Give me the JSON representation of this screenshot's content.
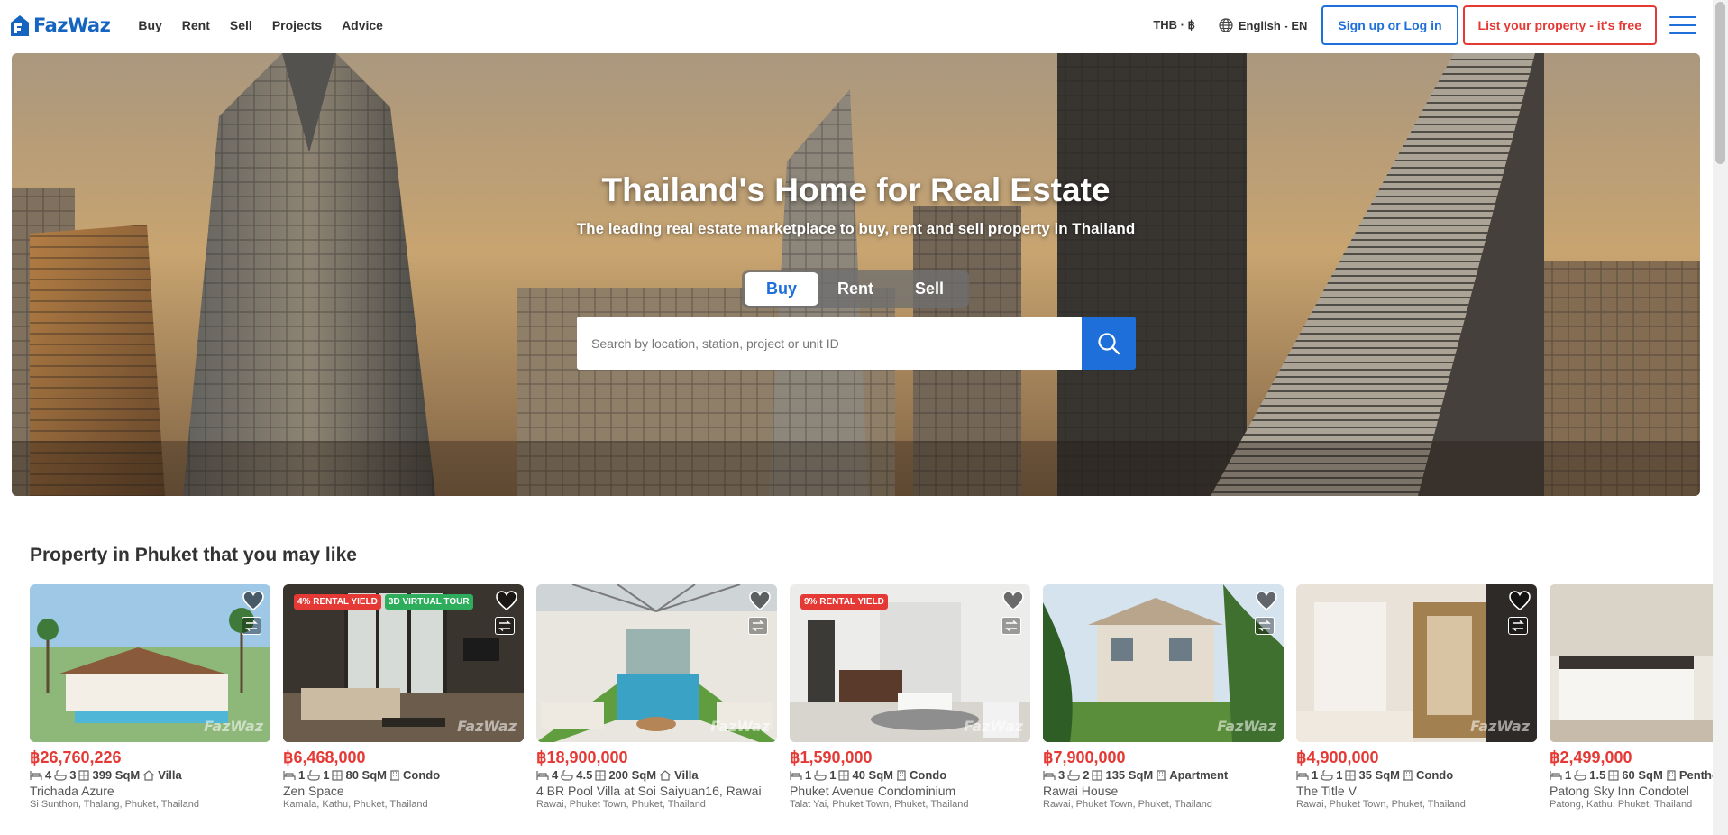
{
  "header": {
    "logo_text": "FazWaz",
    "nav": [
      "Buy",
      "Rent",
      "Sell",
      "Projects",
      "Advice"
    ],
    "currency": "THB · ฿",
    "language": "English - EN",
    "login_label": "Sign up or Log in",
    "list_label": "List your property - it's free",
    "colors": {
      "brand": "#1565c0",
      "primary": "#1e6fd9",
      "danger": "#e53935"
    }
  },
  "hero": {
    "title": "Thailand's Home for Real Estate",
    "subtitle": "The leading real estate marketplace to buy, rent and sell property in Thailand",
    "tabs": [
      "Buy",
      "Rent",
      "Sell"
    ],
    "active_tab": "Buy",
    "search_placeholder": "Search by location, station, project or unit ID"
  },
  "listings": {
    "title": "Property in Phuket that you may like",
    "watermark": "FazWaz",
    "cards": [
      {
        "price": "฿26,760,226",
        "beds": "4",
        "baths": "3",
        "area": "399 SqM",
        "type": "Villa",
        "name": "Trichada Azure",
        "location": "Si Sunthon, Thalang, Phuket, Thailand",
        "badges": []
      },
      {
        "price": "฿6,468,000",
        "beds": "1",
        "baths": "1",
        "area": "80 SqM",
        "type": "Condo",
        "name": "Zen Space",
        "location": "Kamala, Kathu, Phuket, Thailand",
        "badges": [
          {
            "text": "4% RENTAL YIELD",
            "color": "red"
          },
          {
            "text": "3D VIRTUAL TOUR",
            "color": "green"
          }
        ]
      },
      {
        "price": "฿18,900,000",
        "beds": "4",
        "baths": "4.5",
        "area": "200 SqM",
        "type": "Villa",
        "name": "4 BR Pool Villa at Soi Saiyuan16, Rawai",
        "location": "Rawai, Phuket Town, Phuket, Thailand",
        "badges": []
      },
      {
        "price": "฿1,590,000",
        "beds": "1",
        "baths": "1",
        "area": "40 SqM",
        "type": "Condo",
        "name": "Phuket Avenue Condominium",
        "location": "Talat Yai, Phuket Town, Phuket, Thailand",
        "badges": [
          {
            "text": "9% RENTAL YIELD",
            "color": "red"
          }
        ]
      },
      {
        "price": "฿7,900,000",
        "beds": "3",
        "baths": "2",
        "area": "135 SqM",
        "type": "Apartment",
        "name": "Rawai House",
        "location": "Rawai, Phuket Town, Phuket, Thailand",
        "badges": []
      },
      {
        "price": "฿4,900,000",
        "beds": "1",
        "baths": "1",
        "area": "35 SqM",
        "type": "Condo",
        "name": "The Title V",
        "location": "Rawai, Phuket Town, Phuket, Thailand",
        "badges": []
      },
      {
        "price": "฿2,499,000",
        "beds": "1",
        "baths": "1.5",
        "area": "60 SqM",
        "type": "Penthouse",
        "name": "Patong Sky Inn Condotel",
        "location": "Patong, Kathu, Phuket, Thailand",
        "badges": []
      }
    ]
  }
}
